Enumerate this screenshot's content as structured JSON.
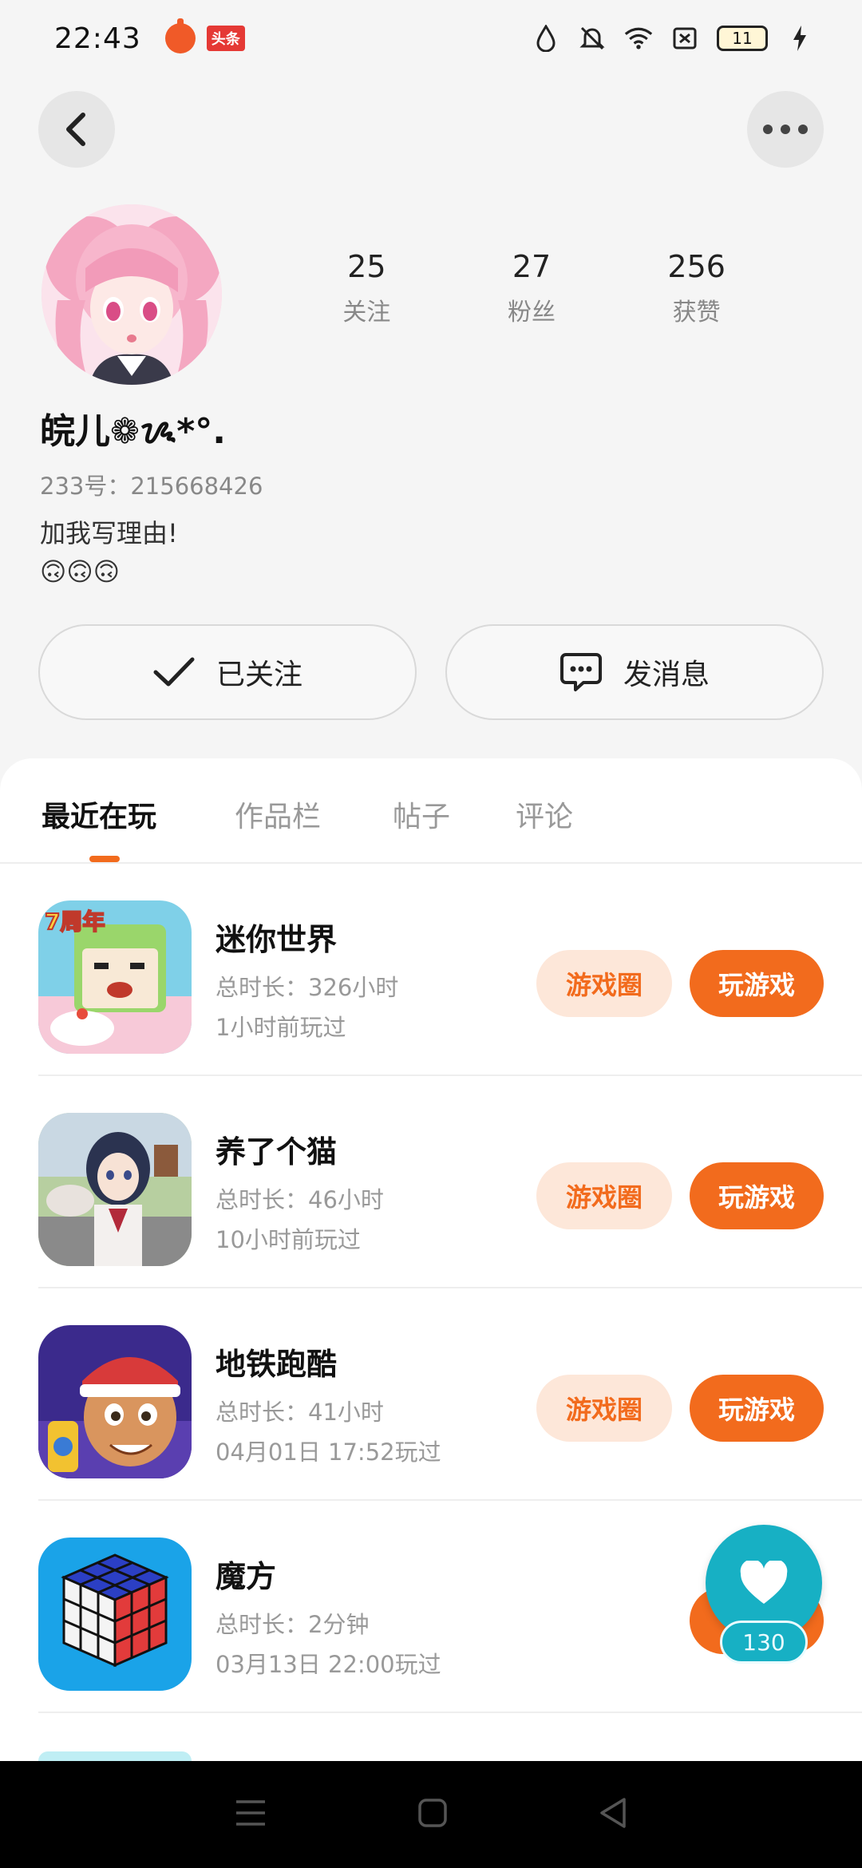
{
  "status_bar": {
    "time": "22:43",
    "badge": "头条",
    "battery": "11"
  },
  "profile": {
    "username": "皖儿❁ᝰ*°.",
    "uid": "233号：215668426",
    "bio_line1": "加我写理由!",
    "bio_line2": "🙃🙃🙃",
    "stats": [
      {
        "value": "25",
        "label": "关注"
      },
      {
        "value": "27",
        "label": "粉丝"
      },
      {
        "value": "256",
        "label": "获赞"
      }
    ]
  },
  "actions": {
    "follow_label": "已关注",
    "message_label": "发消息"
  },
  "tabs": [
    {
      "label": "最近在玩",
      "active": true
    },
    {
      "label": "作品栏",
      "active": false
    },
    {
      "label": "帖子",
      "active": false
    },
    {
      "label": "评论",
      "active": false
    }
  ],
  "games": [
    {
      "name": "迷你世界",
      "duration": "总时长：326小时",
      "last_played": "1小时前玩过",
      "circle_label": "游戏圈",
      "play_label": "玩游戏",
      "icon": "mini-world-icon"
    },
    {
      "name": "养了个猫",
      "duration": "总时长：46小时",
      "last_played": "10小时前玩过",
      "circle_label": "游戏圈",
      "play_label": "玩游戏",
      "icon": "cat-game-icon"
    },
    {
      "name": "地铁跑酷",
      "duration": "总时长：41小时",
      "last_played": "04月01日 17:52玩过",
      "circle_label": "游戏圈",
      "play_label": "玩游戏",
      "icon": "subway-surf-icon"
    },
    {
      "name": "魔方",
      "duration": "总时长：2分钟",
      "last_played": "03月13日 22:00玩过",
      "circle_label": "",
      "play_label": "",
      "icon": "rubiks-cube-icon"
    }
  ],
  "like": {
    "count": "130"
  },
  "colors": {
    "accent": "#f26b1d",
    "accent_light": "#fde7d9",
    "like": "#17b0c4"
  }
}
